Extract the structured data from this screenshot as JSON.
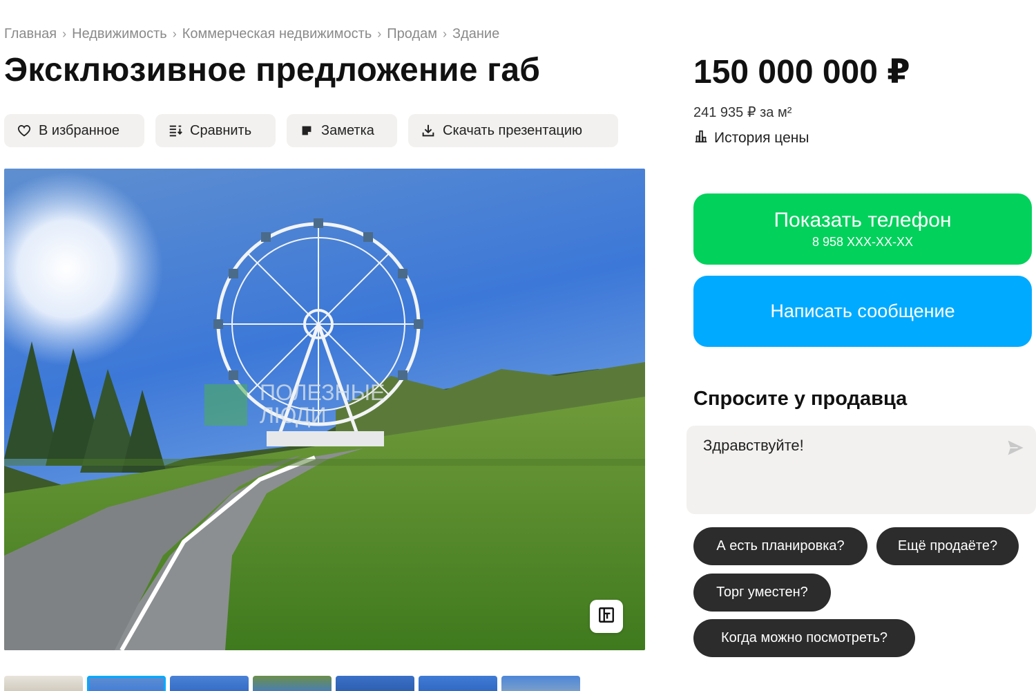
{
  "breadcrumb": [
    {
      "label": "Главная"
    },
    {
      "label": "Недвижимость"
    },
    {
      "label": "Коммерческая недвижимость"
    },
    {
      "label": "Продам"
    },
    {
      "label": "Здание"
    }
  ],
  "breadcrumb_separator": "›",
  "title": "Эксклюзивное предложение габ",
  "actions": {
    "favorite": "В избранное",
    "compare": "Сравнить",
    "note": "Заметка",
    "download": "Скачать презентацию"
  },
  "photo": {
    "watermark_line1": "ПОЛЕЗНЫЕ",
    "watermark_line2": "ЛЮДИ"
  },
  "price": {
    "main": "150 000 000 ₽",
    "per_sqm": "241 935 ₽ за м²",
    "history_label": "История цены"
  },
  "contact": {
    "show_phone": "Показать телефон",
    "phone_masked": "8 958 XXX-XX-XX",
    "write_message": "Написать сообщение"
  },
  "ask_seller": {
    "title": "Спросите у продавца",
    "message_value": "Здравствуйте!",
    "quick_questions": [
      {
        "label": "А есть планировка?"
      },
      {
        "label": "Ещё продаёте?"
      },
      {
        "label": "Торг уместен?"
      },
      {
        "label": "Когда можно посмотреть?"
      }
    ]
  },
  "colors": {
    "green": "#02d15c",
    "blue": "#00aaff",
    "chip_dark": "#2c2c2c",
    "chip_bg": "#f2f1ef"
  },
  "icons": {
    "favorite": "heart-icon",
    "compare": "compare-list-icon",
    "note": "note-icon",
    "download": "download-icon",
    "history": "bar-chart-icon",
    "send": "send-icon",
    "expand": "expand-icon"
  }
}
